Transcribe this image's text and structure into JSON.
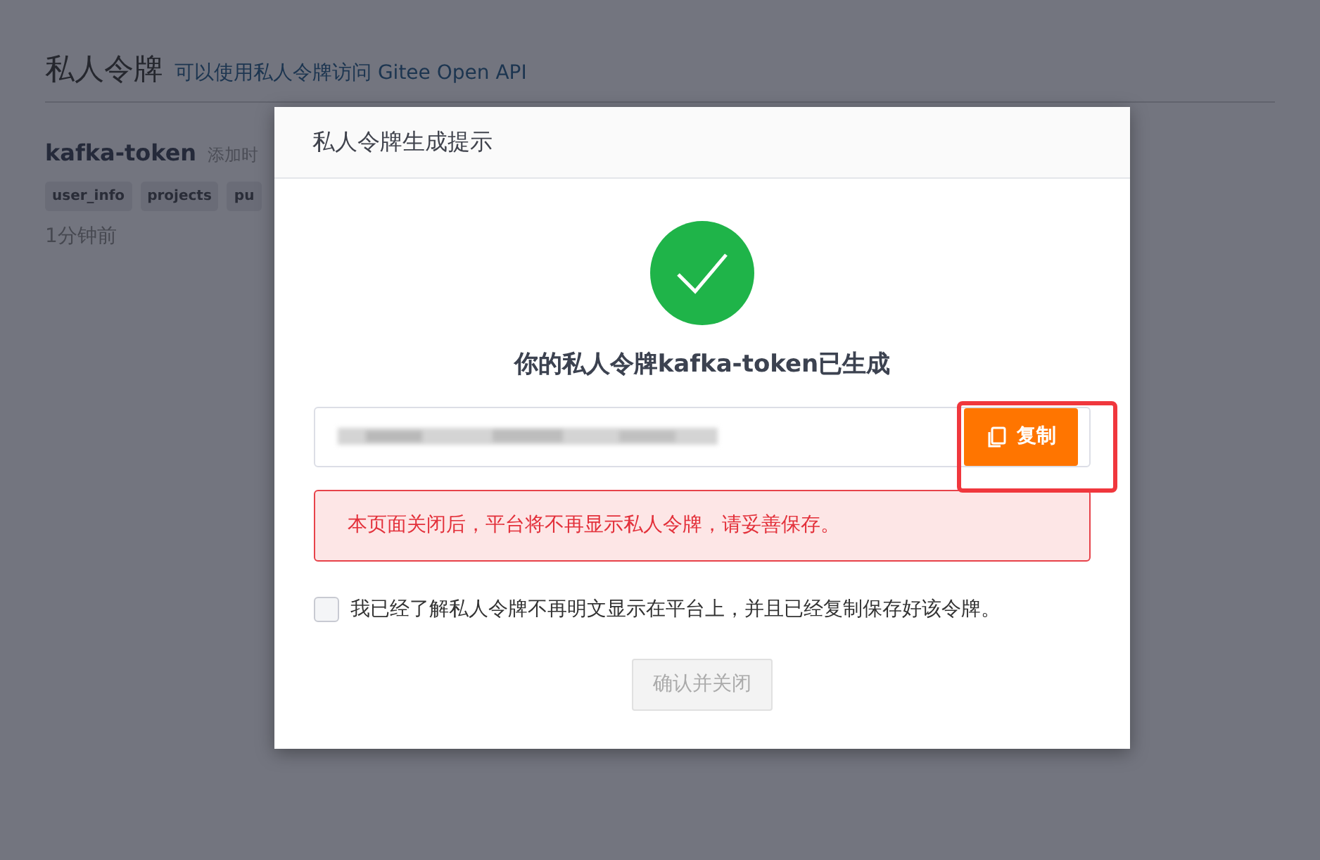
{
  "page": {
    "title": "私人令牌",
    "subtitle": "可以使用私人令牌访问 Gitee Open API",
    "token": {
      "name": "kafka-token",
      "added_label": "添加时",
      "scopes": [
        "user_info",
        "projects",
        "pu"
      ],
      "time": "1分钟前"
    }
  },
  "dialog": {
    "title": "私人令牌生成提示",
    "message": "你的私人令牌kafka-token已生成",
    "copy_button": "复制",
    "warning": "本页面关闭后，平台将不再显示私人令牌，请妥善保存。",
    "acknowledge": {
      "label": "我已经了解私人令牌不再明文显示在平台上，并且已经复制保存好该令牌。",
      "checked": false
    },
    "confirm_button": {
      "label": "确认并关闭",
      "disabled": true
    }
  }
}
